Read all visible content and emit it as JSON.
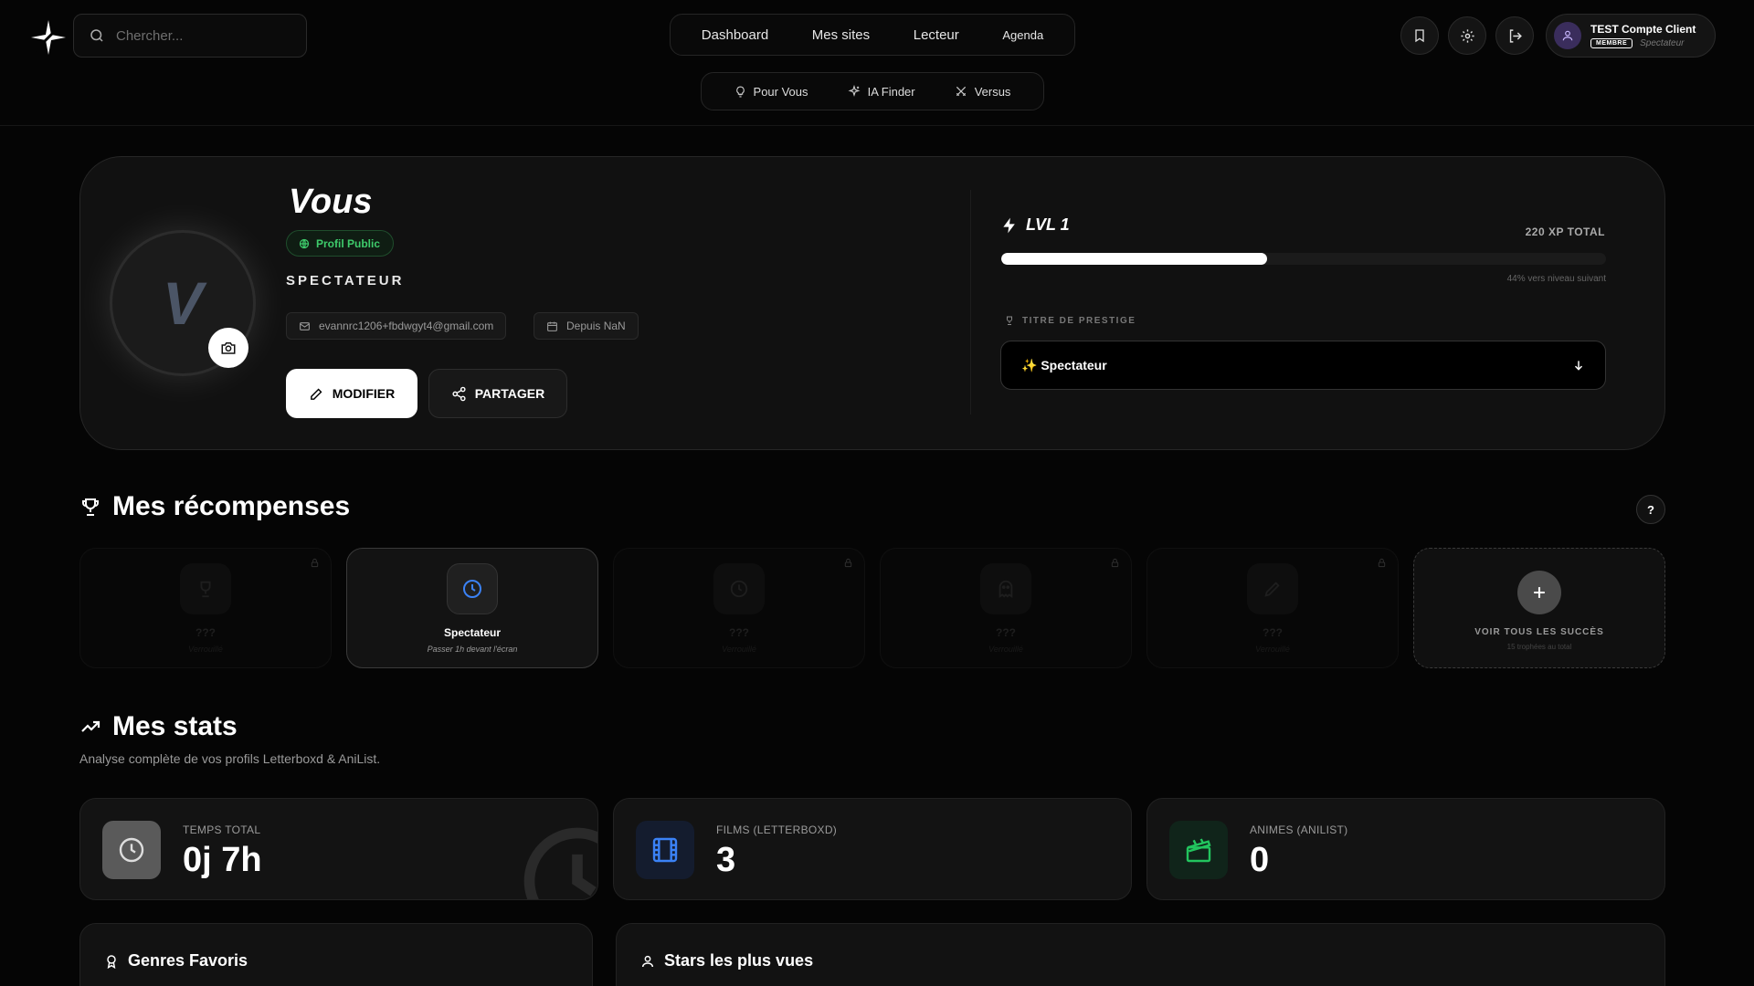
{
  "search": {
    "placeholder": "Chercher..."
  },
  "nav": {
    "items": [
      "Dashboard",
      "Mes sites",
      "Lecteur",
      "Agenda"
    ]
  },
  "subnav": {
    "items": [
      "Pour Vous",
      "IA Finder",
      "Versus"
    ]
  },
  "user": {
    "name": "TEST Compte Client",
    "badge": "MEMBRE",
    "role": "Spectateur"
  },
  "profile": {
    "name": "Vous",
    "avatar_letter": "V",
    "visibility": "Profil Public",
    "title": "SPECTATEUR",
    "email": "evannrc1206+fbdwgyt4@gmail.com",
    "since": "Depuis NaN",
    "edit_label": "MODIFIER",
    "share_label": "PARTAGER"
  },
  "level": {
    "label": "LVL 1",
    "xp_total": "220 XP TOTAL",
    "progress_percent": 44,
    "progress_text": "44% vers niveau suivant",
    "prestige_label": "TITRE DE PRESTIGE",
    "prestige_value": "✨ Spectateur"
  },
  "rewards": {
    "title": "Mes récompenses",
    "help": "?",
    "items": [
      {
        "title": "???",
        "desc": "Verrouillé",
        "icon": "trophy-icon",
        "locked": true
      },
      {
        "title": "Spectateur",
        "desc": "Passer 1h devant l'écran",
        "icon": "clock-icon",
        "locked": false
      },
      {
        "title": "???",
        "desc": "Verrouillé",
        "icon": "clock-icon",
        "locked": true
      },
      {
        "title": "???",
        "desc": "Verrouillé",
        "icon": "ghost-icon",
        "locked": true
      },
      {
        "title": "???",
        "desc": "Verrouillé",
        "icon": "pen-icon",
        "locked": true
      }
    ],
    "see_all": "VOIR TOUS LES SUCCÈS",
    "total": "15 trophées au total"
  },
  "stats": {
    "title": "Mes stats",
    "subtitle": "Analyse complète de vos profils Letterboxd & AniList.",
    "cards": [
      {
        "label": "TEMPS TOTAL",
        "value": "0j 7h",
        "icon": "clock-icon"
      },
      {
        "label": "FILMS (LETTERBOXD)",
        "value": "3",
        "icon": "film-icon"
      },
      {
        "label": "ANIMES (ANILIST)",
        "value": "0",
        "icon": "clapperboard-icon"
      }
    ]
  },
  "genres": {
    "title": "Genres Favoris"
  },
  "stars": {
    "title": "Stars les plus vues"
  },
  "colors": {
    "accent_green": "#3ecb6b",
    "film_blue": "#3b82f6",
    "anime_green": "#22c55e"
  }
}
